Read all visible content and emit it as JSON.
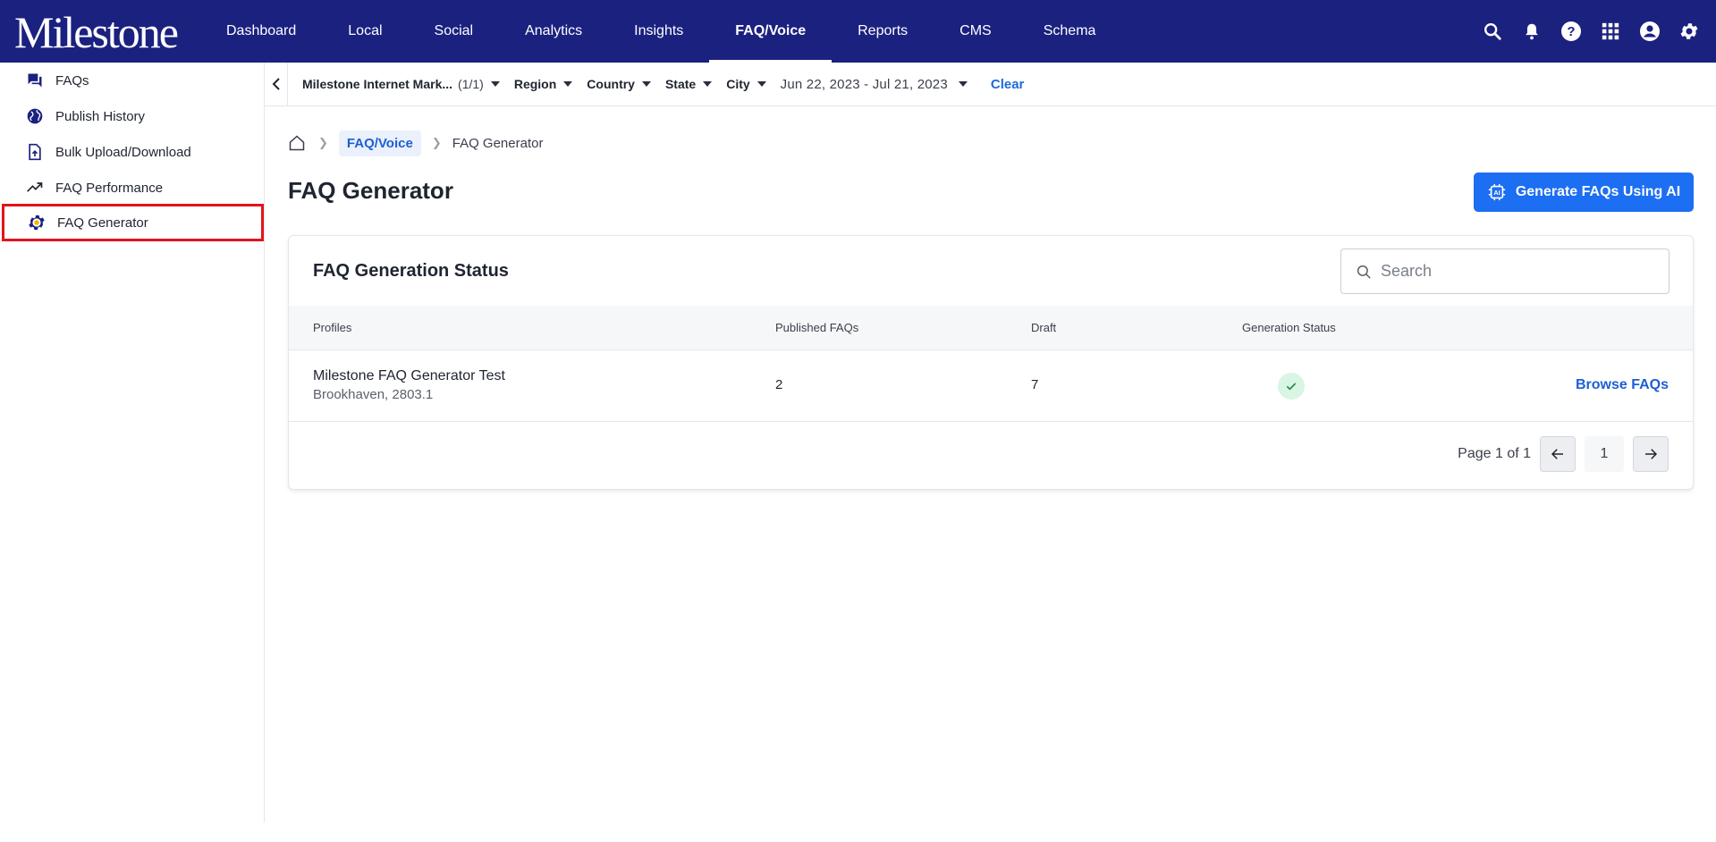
{
  "app": {
    "logo_text": "Milestone"
  },
  "nav": {
    "items": [
      {
        "label": "Dashboard"
      },
      {
        "label": "Local"
      },
      {
        "label": "Social"
      },
      {
        "label": "Analytics"
      },
      {
        "label": "Insights"
      },
      {
        "label": "FAQ/Voice",
        "active": true
      },
      {
        "label": "Reports"
      },
      {
        "label": "CMS"
      },
      {
        "label": "Schema"
      }
    ],
    "icons": [
      "search-icon",
      "bell-icon",
      "help-icon",
      "apps-grid-icon",
      "account-icon",
      "settings-icon"
    ]
  },
  "sidebar": {
    "items": [
      {
        "label": "FAQs",
        "icon": "forum-icon"
      },
      {
        "label": "Publish History",
        "icon": "globe-icon"
      },
      {
        "label": "Bulk Upload/Download",
        "icon": "file-upload-icon"
      },
      {
        "label": "FAQ Performance",
        "icon": "trending-up-icon"
      },
      {
        "label": "FAQ Generator",
        "icon": "gear-star-icon",
        "highlighted": true
      }
    ]
  },
  "filters": {
    "business": "Milestone Internet Mark...",
    "business_count": "(1/1)",
    "region": "Region",
    "country": "Country",
    "state": "State",
    "city": "City",
    "date_range": "Jun 22, 2023 - Jul 21, 2023",
    "clear_label": "Clear"
  },
  "breadcrumb": {
    "parent": "FAQ/Voice",
    "current": "FAQ Generator"
  },
  "page": {
    "title": "FAQ Generator",
    "generate_button": "Generate FAQs Using AI",
    "accent_color": "#1c6ef2",
    "nav_color": "#1b217f"
  },
  "card": {
    "title": "FAQ Generation Status",
    "search_placeholder": "Search",
    "columns": {
      "profiles": "Profiles",
      "published": "Published FAQs",
      "draft": "Draft",
      "status": "Generation Status"
    },
    "rows": [
      {
        "profile_name": "Milestone FAQ Generator Test",
        "profile_location": "Brookhaven, 2803.1",
        "published": "2",
        "draft": "7",
        "status_icon": "check-icon",
        "action": "Browse FAQs"
      }
    ],
    "pager": {
      "label": "Page 1 of 1",
      "current_page": "1"
    }
  }
}
